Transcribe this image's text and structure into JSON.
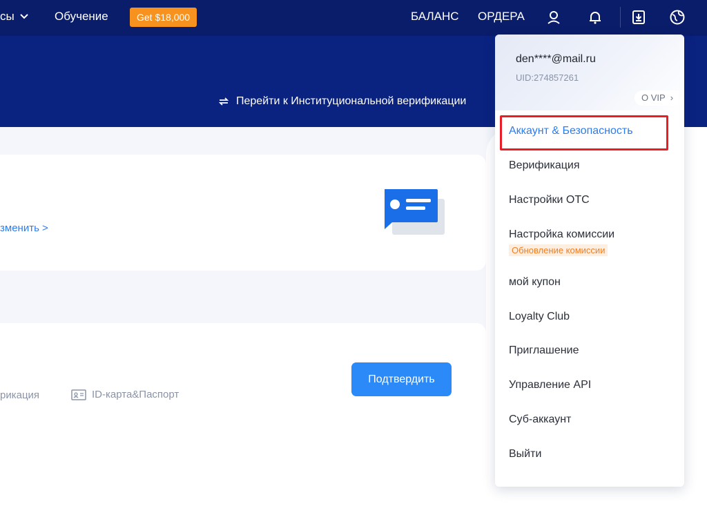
{
  "topnav": {
    "assets_label": "сы",
    "learn_label": "Обучение",
    "promo_label": "Get $18,000",
    "balance_label": "БАЛАНС",
    "orders_label": "ОРДЕРА"
  },
  "banner": {
    "institutional_link": "Перейти к Институциональной верификации"
  },
  "card1": {
    "change_link": "зменить >"
  },
  "card2": {
    "verification_text": "рикация",
    "id_doc_label": "ID-карта&Паспорт",
    "confirm_label": "Подтвердить"
  },
  "dropdown": {
    "email": "den****@mail.ru",
    "uid": "UID:274857261",
    "vip_label": "O VIP",
    "items": [
      {
        "label": "Аккаунт & Безопасность"
      },
      {
        "label": "Верификация"
      },
      {
        "label": "Настройки ОТС"
      },
      {
        "label": "Настройка комиссии"
      },
      {
        "label": "мой купон"
      },
      {
        "label": "Loyalty Club"
      },
      {
        "label": "Приглашение"
      },
      {
        "label": "Управление API"
      },
      {
        "label": "Суб-аккаунт"
      },
      {
        "label": "Выйти"
      }
    ],
    "fee_update_badge": "Обновление комиссии"
  },
  "colors": {
    "nav_bg": "#0a1d6b",
    "banner_bg": "#0a2280",
    "accent": "#2b8af8",
    "promo": "#f7921e",
    "highlight": "#e81d25"
  }
}
